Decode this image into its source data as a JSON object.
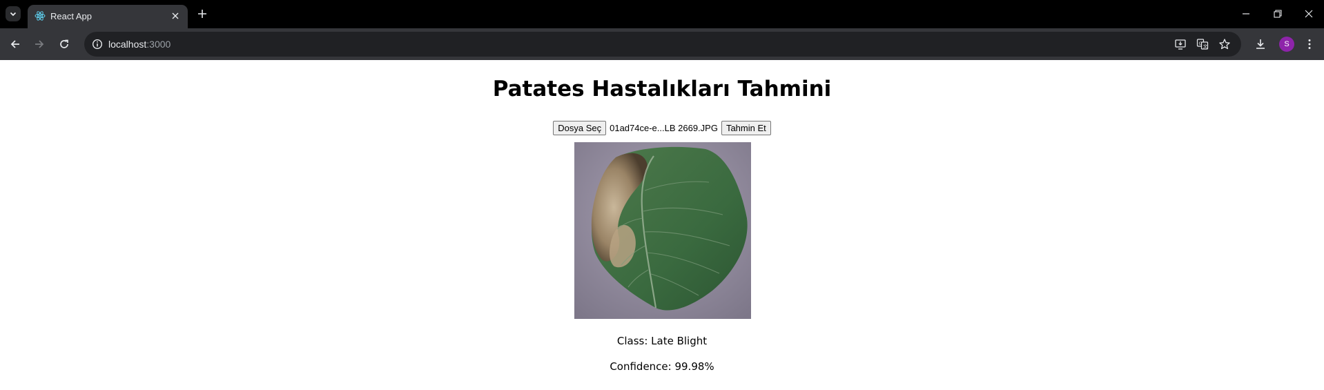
{
  "browser": {
    "tab_title": "React App",
    "url_host": "localhost",
    "url_port": ":3000",
    "avatar_letter": "S"
  },
  "page": {
    "title": "Patates Hastalıkları Tahmini",
    "choose_file_label": "Dosya Seç",
    "file_name": "01ad74ce-e...LB 2669.JPG",
    "predict_label": "Tahmin Et",
    "result_class": "Class: Late Blight",
    "result_confidence": "Confidence: 99.98%"
  },
  "colors": {
    "tabstrip_bg": "#000000",
    "toolbar_bg": "#35363a",
    "omnibox_bg": "#202124",
    "avatar_bg": "#8e24aa"
  }
}
